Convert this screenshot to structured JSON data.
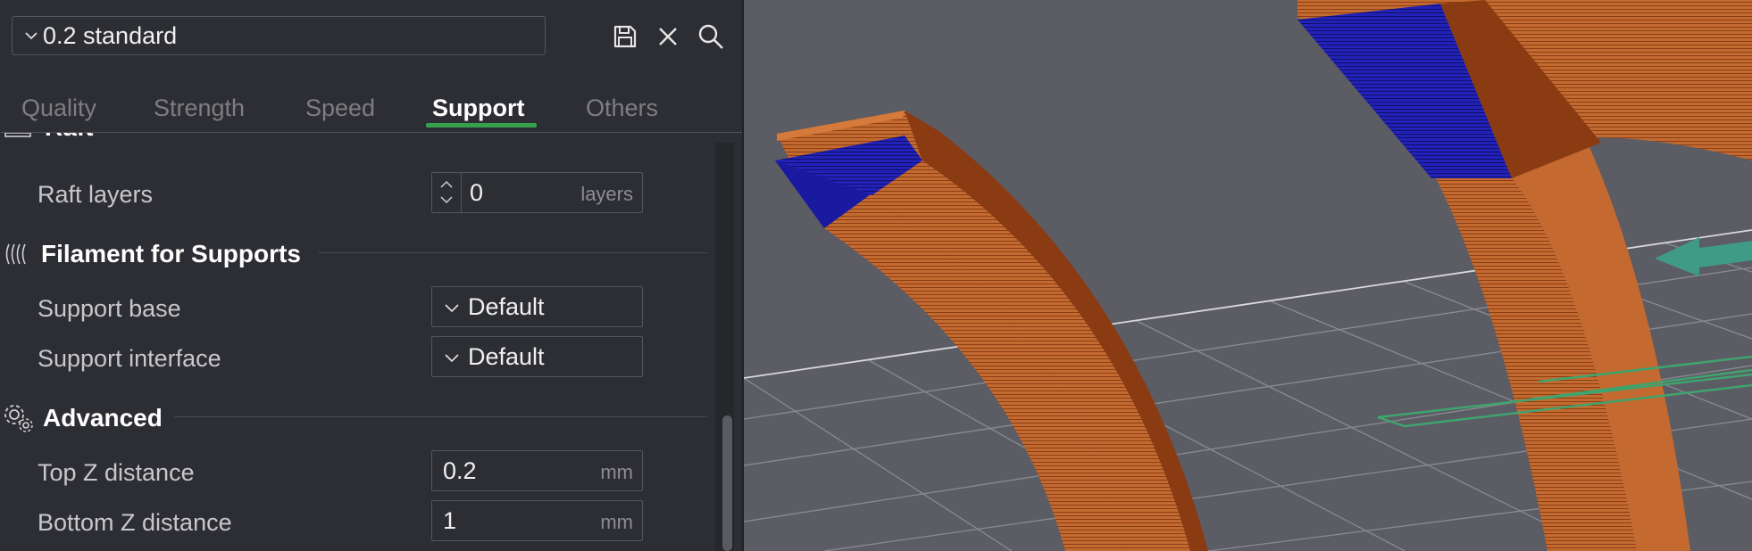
{
  "preset": {
    "value": "0.2 standard"
  },
  "toolbar": {
    "save": "save-icon",
    "close": "close-icon",
    "search": "search-icon"
  },
  "tabs": [
    {
      "label": "Quality"
    },
    {
      "label": "Strength"
    },
    {
      "label": "Speed"
    },
    {
      "label": "Support"
    },
    {
      "label": "Others"
    }
  ],
  "active_tab": "Support",
  "sections": {
    "raft": {
      "title": "Raft",
      "raft_layers": {
        "label": "Raft layers",
        "value": "0",
        "unit": "layers"
      }
    },
    "filament": {
      "title": "Filament for Supports",
      "support_base": {
        "label": "Support base",
        "value": "Default"
      },
      "support_interface": {
        "label": "Support interface",
        "value": "Default"
      }
    },
    "advanced": {
      "title": "Advanced",
      "top_z": {
        "label": "Top Z distance",
        "value": "0.2",
        "unit": "mm"
      },
      "bottom_z": {
        "label": "Bottom Z distance",
        "value": "1",
        "unit": "mm"
      }
    }
  },
  "colors": {
    "accent": "#37a04f",
    "model_orange": "#c0622a",
    "model_blue": "#2020b0",
    "support_green": "#3fa46e",
    "viewport_bg": "#5c5c64"
  }
}
